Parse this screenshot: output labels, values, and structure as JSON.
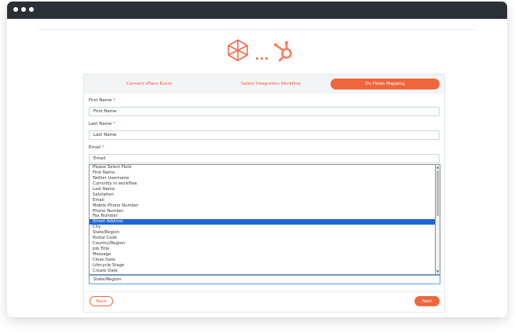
{
  "steps": [
    {
      "label": "Connect VFairs Event"
    },
    {
      "label": "Select Integration Workflow"
    },
    {
      "label": "Do Fields Mapping"
    }
  ],
  "fields": {
    "first_name": {
      "label": "First Name",
      "required_mark": "*",
      "value": "First Name"
    },
    "last_name": {
      "label": "Last Name",
      "required_mark": "*",
      "value": "Last Name"
    },
    "email": {
      "label": "Email",
      "required_mark": "*",
      "value": "Email"
    }
  },
  "dropdown": {
    "options": [
      "Please Select Field",
      "First Name",
      "Twitter Username",
      "Currently in workflow",
      "Last Name",
      "Salutation",
      "Email",
      "Mobile Phone Number",
      "Phone Number",
      "Fax Number",
      "Street Address",
      "City",
      "State/Region",
      "Postal Code",
      "Country/Region",
      "Job Title",
      "Message",
      "Close Date",
      "Lifecycle Stage",
      "Create Date"
    ],
    "highlighted": "Street Address",
    "selected_value": "State/Region"
  },
  "buttons": {
    "back": "Back",
    "next": "Next"
  },
  "colors": {
    "accent": "#f0663c",
    "selection": "#1f66d4"
  }
}
